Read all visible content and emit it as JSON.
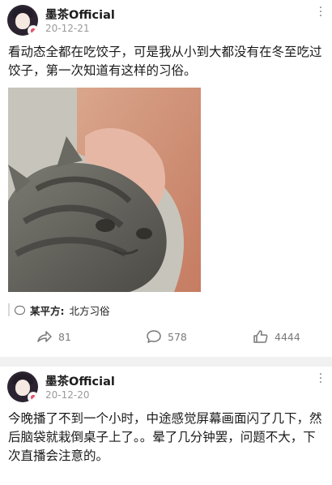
{
  "posts": [
    {
      "author": "墨茶Official",
      "date": "20-12-21",
      "text": "看动态全都在吃饺子，可是我从小到大都没有在冬至吃过饺子，第一次知道有这样的习俗。",
      "location_name": "某平方:",
      "location_topic": "北方习俗",
      "shares": "81",
      "comments": "578",
      "likes": "4444"
    },
    {
      "author": "墨茶Official",
      "date": "20-12-20",
      "text": "今晚播了不到一个小时，中途感觉屏幕画面闪了几下，然后脑袋就栽倒桌子上了。。晕了几分钟罢，问题不大，下次直播会注意的。"
    }
  ],
  "icons": {
    "more": "more-vertical-icon",
    "share": "share-arrow-icon",
    "comment": "comment-bubble-icon",
    "like": "thumbs-up-icon",
    "location": "chat-bubble-icon"
  }
}
